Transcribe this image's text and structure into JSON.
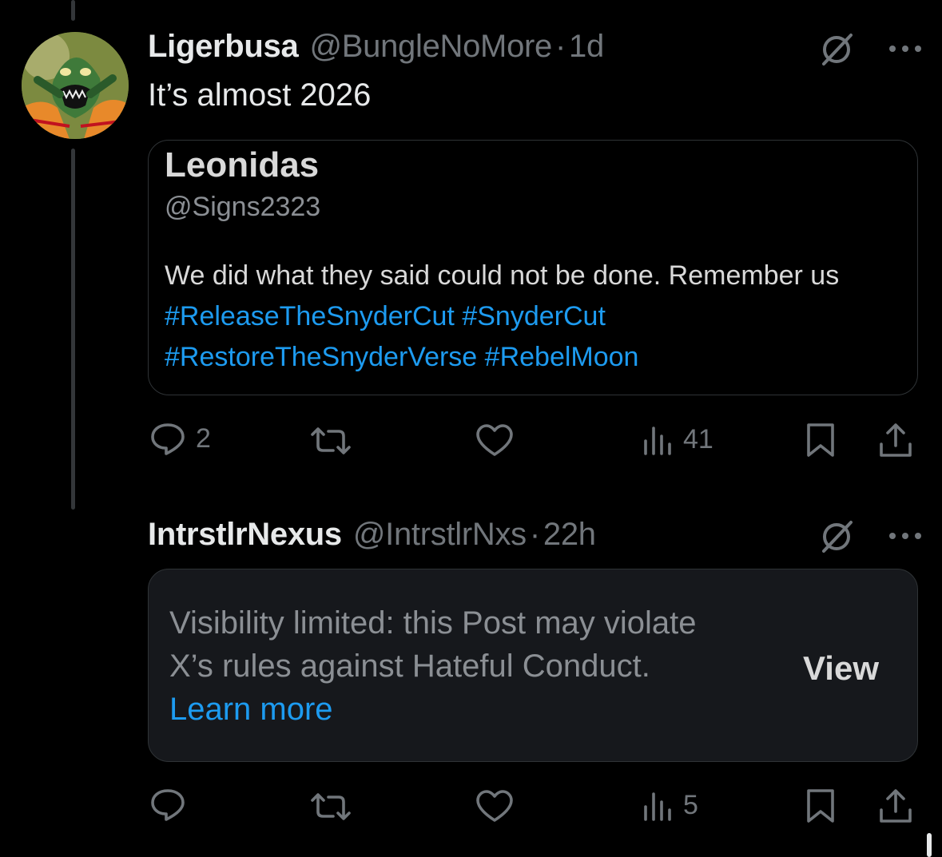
{
  "post1": {
    "display_name": "Ligerbusa",
    "handle": "@BungleNoMore",
    "separator": "·",
    "time": "1d",
    "text": "It’s almost 2026",
    "avatar_icon": "cartoon-avatar",
    "quote": {
      "name": "Leonidas",
      "handle": "@Signs2323",
      "text": "We did what they said could not be done. Remember us",
      "hashtags": [
        "#ReleaseTheSnyderCut",
        "#SnyderCut",
        "#RestoreTheSnyderVerse",
        "#RebelMoon"
      ]
    },
    "actions": {
      "replies": "2",
      "reposts": "",
      "likes": "",
      "views": "41"
    }
  },
  "post2": {
    "display_name": "IntrstlrNexus",
    "handle": "@IntrstlrNxs",
    "separator": "·",
    "time": "22h",
    "notice_text": "Visibility limited: this Post may violate X’s rules against Hateful Conduct.",
    "learn_more": "Learn more",
    "view_label": "View",
    "actions": {
      "replies": "",
      "reposts": "",
      "likes": "",
      "views": "5"
    }
  },
  "colors": {
    "background": "#000000",
    "primary_text": "#e7e9ea",
    "secondary_text": "#71767b",
    "link": "#1d9bf0",
    "card_background": "#16181c",
    "border": "#2f3336"
  }
}
